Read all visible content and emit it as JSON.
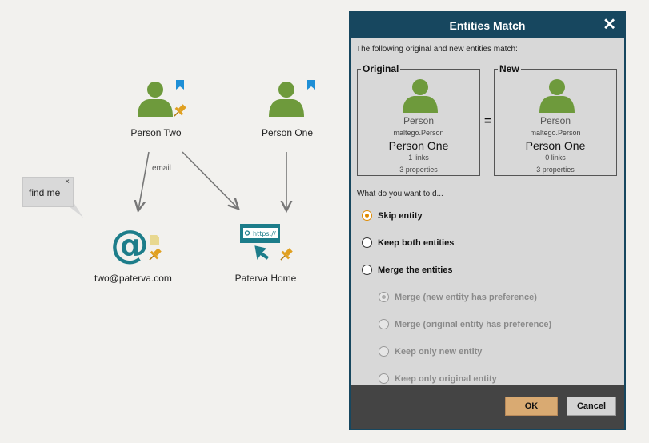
{
  "graph": {
    "nodes": [
      {
        "id": "person_two",
        "label": "Person Two",
        "type": "person"
      },
      {
        "id": "person_one",
        "label": "Person One",
        "type": "person"
      },
      {
        "id": "email",
        "label": "two@paterva.com",
        "type": "email"
      },
      {
        "id": "website",
        "label": "Paterva Home",
        "type": "website",
        "url_text": "https://"
      }
    ],
    "edge_label": "email",
    "note": {
      "text": "find me",
      "close": "×"
    }
  },
  "dialog": {
    "title": "Entities Match",
    "close": "✕",
    "intro": "The following original and new entities match:",
    "original": {
      "legend": "Original",
      "type": "Person",
      "id": "maltego.Person",
      "name": "Person One",
      "links": "1 links",
      "properties": "3 properties"
    },
    "equals": "=",
    "new": {
      "legend": "New",
      "type": "Person",
      "id": "maltego.Person",
      "name": "Person One",
      "links": "0 links",
      "properties": "3 properties"
    },
    "question": "What do you want to d...",
    "options": [
      {
        "label": "Skip entity",
        "selected": true
      },
      {
        "label": "Keep both entities",
        "selected": false
      },
      {
        "label": "Merge the entities",
        "selected": false
      }
    ],
    "sub_options": [
      {
        "label": "Merge (new entity has preference)",
        "selected": true
      },
      {
        "label": "Merge (original entity has preference)",
        "selected": false
      },
      {
        "label": "Keep only new entity",
        "selected": false
      },
      {
        "label": "Keep only original entity",
        "selected": false
      }
    ],
    "ok": "OK",
    "cancel": "Cancel"
  },
  "colors": {
    "person": "#6e9a3c",
    "teal": "#1d7d8a",
    "bookmark": "#1e8fd6",
    "pin": "#e0a020",
    "dialog_header": "#17475f",
    "ok_button": "#d9aa72"
  }
}
